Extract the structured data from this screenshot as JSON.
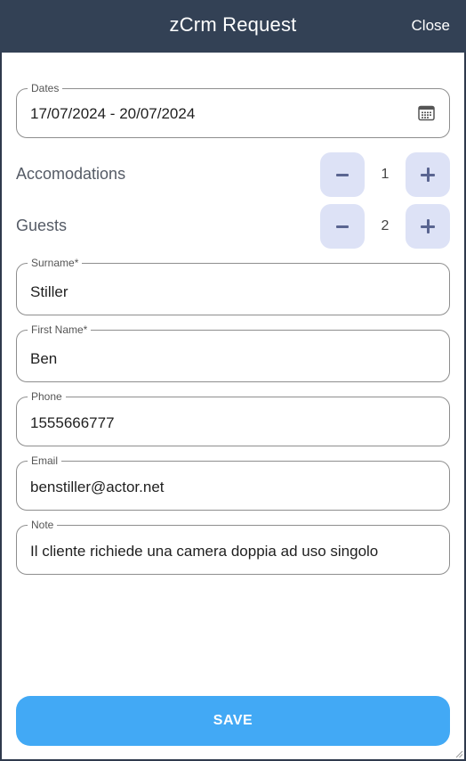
{
  "header": {
    "title": "zCrm Request",
    "close_label": "Close"
  },
  "form": {
    "dates": {
      "label": "Dates",
      "value": "17/07/2024 - 20/07/2024",
      "icon": "calendar-icon"
    },
    "accommodations": {
      "label": "Accomodations",
      "value": "1"
    },
    "guests": {
      "label": "Guests",
      "value": "2"
    },
    "surname": {
      "label": "Surname*",
      "value": "Stiller"
    },
    "first_name": {
      "label": "First Name*",
      "value": "Ben"
    },
    "phone": {
      "label": "Phone",
      "value": "1555666777"
    },
    "email": {
      "label": "Email",
      "value": "benstiller@actor.net"
    },
    "note": {
      "label": "Note",
      "value": "Il cliente richiede una camera doppia ad uso singolo"
    }
  },
  "actions": {
    "save_label": "SAVE"
  },
  "colors": {
    "header_bg": "#334155",
    "save_bg": "#42a9f5",
    "stepper_bg": "#dde2f6",
    "stepper_icon": "#5a6591"
  }
}
